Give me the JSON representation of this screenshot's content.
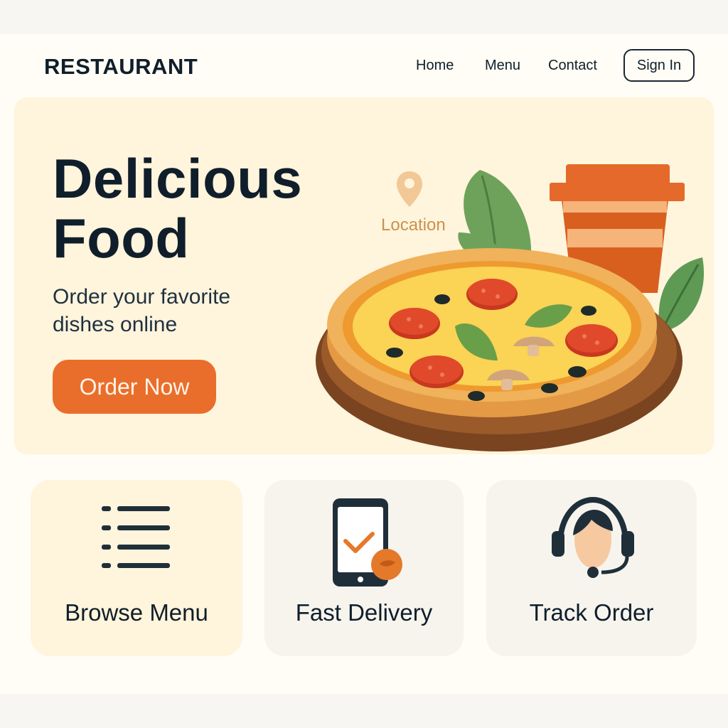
{
  "header": {
    "brand": "RESTAURANT",
    "nav": [
      {
        "label": "Home"
      },
      {
        "label": "Menu"
      },
      {
        "label": "Contact"
      }
    ],
    "sign_in": "Sign In"
  },
  "hero": {
    "title_line1": "Delicious",
    "title_line2": "Food",
    "subtitle": "Order your favorite dishes online",
    "cta": "Order Now",
    "location_label": "Location",
    "illustration": "pizza-and-drink"
  },
  "features": [
    {
      "label": "Browse Menu",
      "icon": "list-icon"
    },
    {
      "label": "Fast Delivery",
      "icon": "phone-check-icon"
    },
    {
      "label": "Track Order",
      "icon": "support-agent-icon"
    }
  ],
  "colors": {
    "accent": "#ea6e2b",
    "hero_bg": "#fff4dc",
    "text": "#0f1e2a",
    "location": "#c9924d"
  }
}
